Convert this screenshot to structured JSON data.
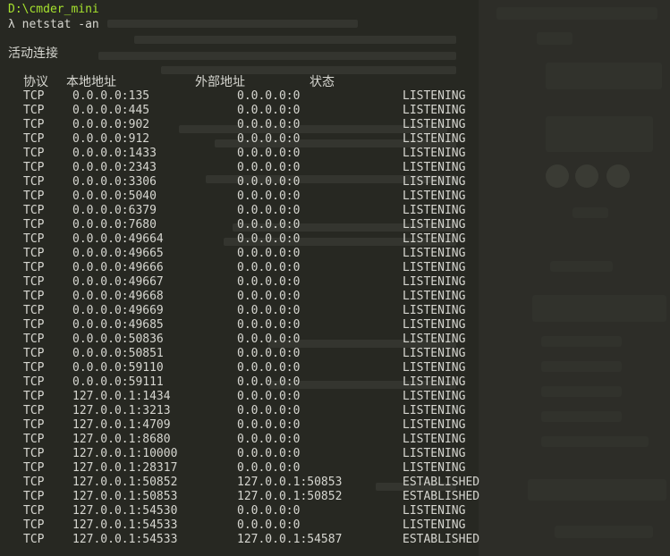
{
  "terminal": {
    "cwd": "D:\\cmder_mini",
    "prompt_symbol": "λ",
    "command": "netstat -an",
    "section_title": "活动连接",
    "columns": [
      "协议",
      "本地地址",
      "外部地址",
      "状态"
    ],
    "rows": [
      [
        "TCP",
        "0.0.0.0:135",
        "0.0.0.0:0",
        "LISTENING"
      ],
      [
        "TCP",
        "0.0.0.0:445",
        "0.0.0.0:0",
        "LISTENING"
      ],
      [
        "TCP",
        "0.0.0.0:902",
        "0.0.0.0:0",
        "LISTENING"
      ],
      [
        "TCP",
        "0.0.0.0:912",
        "0.0.0.0:0",
        "LISTENING"
      ],
      [
        "TCP",
        "0.0.0.0:1433",
        "0.0.0.0:0",
        "LISTENING"
      ],
      [
        "TCP",
        "0.0.0.0:2343",
        "0.0.0.0:0",
        "LISTENING"
      ],
      [
        "TCP",
        "0.0.0.0:3306",
        "0.0.0.0:0",
        "LISTENING"
      ],
      [
        "TCP",
        "0.0.0.0:5040",
        "0.0.0.0:0",
        "LISTENING"
      ],
      [
        "TCP",
        "0.0.0.0:6379",
        "0.0.0.0:0",
        "LISTENING"
      ],
      [
        "TCP",
        "0.0.0.0:7680",
        "0.0.0.0:0",
        "LISTENING"
      ],
      [
        "TCP",
        "0.0.0.0:49664",
        "0.0.0.0:0",
        "LISTENING"
      ],
      [
        "TCP",
        "0.0.0.0:49665",
        "0.0.0.0:0",
        "LISTENING"
      ],
      [
        "TCP",
        "0.0.0.0:49666",
        "0.0.0.0:0",
        "LISTENING"
      ],
      [
        "TCP",
        "0.0.0.0:49667",
        "0.0.0.0:0",
        "LISTENING"
      ],
      [
        "TCP",
        "0.0.0.0:49668",
        "0.0.0.0:0",
        "LISTENING"
      ],
      [
        "TCP",
        "0.0.0.0:49669",
        "0.0.0.0:0",
        "LISTENING"
      ],
      [
        "TCP",
        "0.0.0.0:49685",
        "0.0.0.0:0",
        "LISTENING"
      ],
      [
        "TCP",
        "0.0.0.0:50836",
        "0.0.0.0:0",
        "LISTENING"
      ],
      [
        "TCP",
        "0.0.0.0:50851",
        "0.0.0.0:0",
        "LISTENING"
      ],
      [
        "TCP",
        "0.0.0.0:59110",
        "0.0.0.0:0",
        "LISTENING"
      ],
      [
        "TCP",
        "0.0.0.0:59111",
        "0.0.0.0:0",
        "LISTENING"
      ],
      [
        "TCP",
        "127.0.0.1:1434",
        "0.0.0.0:0",
        "LISTENING"
      ],
      [
        "TCP",
        "127.0.0.1:3213",
        "0.0.0.0:0",
        "LISTENING"
      ],
      [
        "TCP",
        "127.0.0.1:4709",
        "0.0.0.0:0",
        "LISTENING"
      ],
      [
        "TCP",
        "127.0.0.1:8680",
        "0.0.0.0:0",
        "LISTENING"
      ],
      [
        "TCP",
        "127.0.0.1:10000",
        "0.0.0.0:0",
        "LISTENING"
      ],
      [
        "TCP",
        "127.0.0.1:28317",
        "0.0.0.0:0",
        "LISTENING"
      ],
      [
        "TCP",
        "127.0.0.1:50852",
        "127.0.0.1:50853",
        "ESTABLISHED"
      ],
      [
        "TCP",
        "127.0.0.1:50853",
        "127.0.0.1:50852",
        "ESTABLISHED"
      ],
      [
        "TCP",
        "127.0.0.1:54530",
        "0.0.0.0:0",
        "LISTENING"
      ],
      [
        "TCP",
        "127.0.0.1:54533",
        "0.0.0.0:0",
        "LISTENING"
      ],
      [
        "TCP",
        "127.0.0.1:54533",
        "127.0.0.1:54587",
        "ESTABLISHED"
      ]
    ]
  },
  "colors": {
    "background": "#272822",
    "text": "#d6d6d0",
    "path": "#a6e22e"
  }
}
